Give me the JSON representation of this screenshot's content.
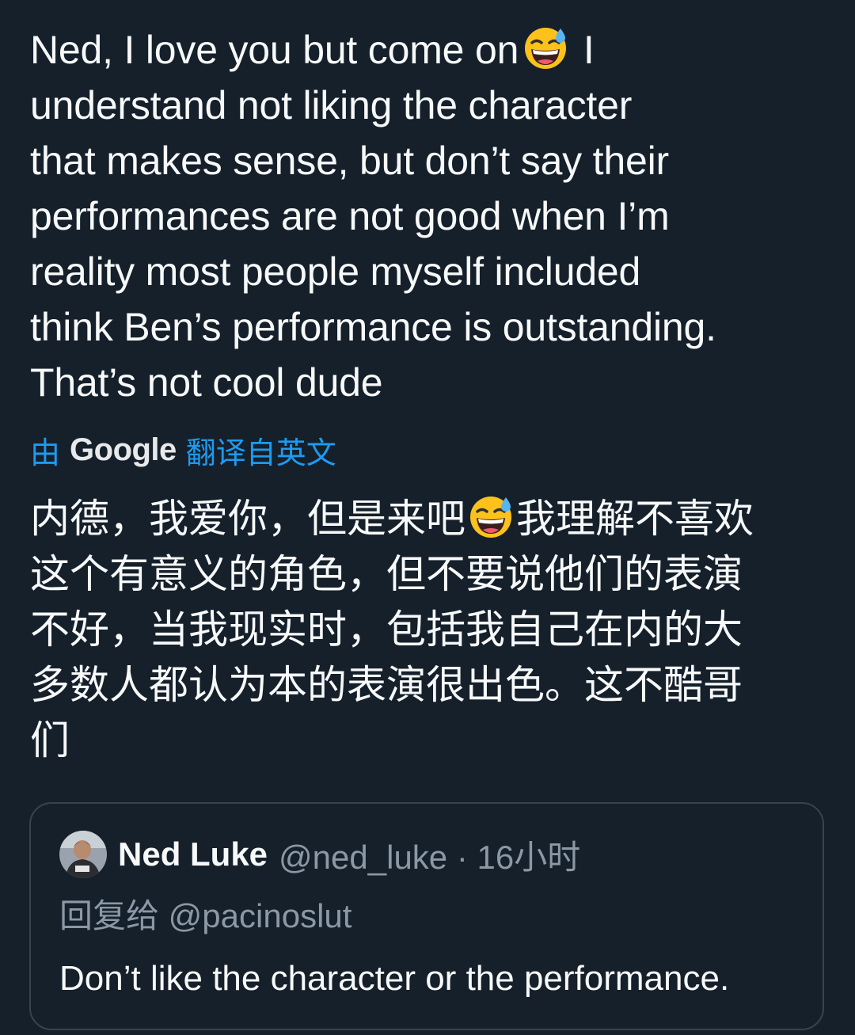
{
  "tweet": {
    "text_part1": "Ned, I love you but come on",
    "emoji": "grinning-face-with-sweat-emoji",
    "text_part2": " I\nunderstand not liking the character\nthat makes sense, but don’t say their\nperformances are not good when I’m\nreality most people myself included\nthink Ben’s performance is outstanding.\nThat’s not cool dude"
  },
  "translation": {
    "prefix": "由",
    "provider": "Google",
    "suffix": "翻译自英文",
    "text_part1": "内德，我爱你，但是来吧",
    "text_part2": "我理解不喜欢\n这个有意义的角色，但不要说他们的表演\n不好，当我现实时，包括我自己在内的大\n多数人都认为本的表演很出色。这不酷哥\n们"
  },
  "quoted_tweet": {
    "display_name": "Ned Luke",
    "handle": "@ned_luke",
    "separator": " · ",
    "time": "16小时",
    "reply_to": "回复给 @pacinoslut",
    "text": "Don’t like the character or the performance."
  },
  "colors": {
    "background": "#15202b",
    "text": "#f7f9f9",
    "secondary": "#8b98a5",
    "accent": "#1d9bf0",
    "border": "#38444d"
  },
  "icons": [
    "grinning-face-with-sweat-emoji",
    "avatar"
  ]
}
